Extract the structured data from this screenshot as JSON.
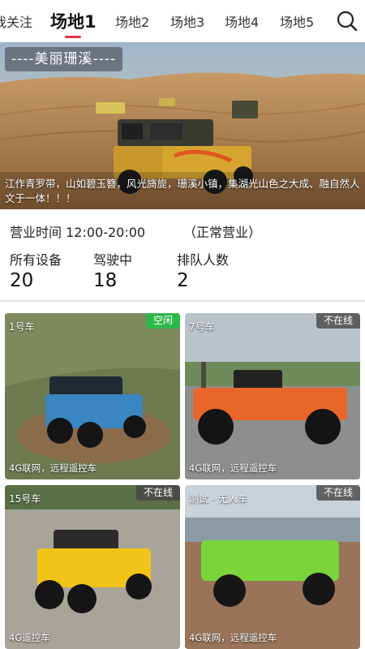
{
  "tabs": [
    {
      "label": "我关注",
      "active": false
    },
    {
      "label": "场地1",
      "active": true
    },
    {
      "label": "场地2",
      "active": false
    },
    {
      "label": "场地3",
      "active": false
    },
    {
      "label": "场地4",
      "active": false
    },
    {
      "label": "场地5",
      "active": false
    }
  ],
  "search_icon": "search-icon",
  "banner": {
    "title": "----美丽珊溪----",
    "caption": "江作青罗带，山如碧玉簪，风光旖旎，珊溪小镇，集湖光山色之大成、融自然人文于一体！！！"
  },
  "venue": {
    "hours": "营业时间 12:00-20:00",
    "status": "（正常营业）",
    "stats": [
      {
        "label": "所有设备",
        "value": "20"
      },
      {
        "label": "驾驶中",
        "value": "18"
      },
      {
        "label": "排队人数",
        "value": "2"
      }
    ]
  },
  "colors": {
    "accent": "#e2334a",
    "idle_badge": "#2eb84c",
    "offline_badge": "#464646"
  },
  "cars": [
    {
      "name": "1号车",
      "badge": "空闲",
      "badge_type": "idle",
      "desc": "4G联网，远程遥控车",
      "body_color": "#3a86c0"
    },
    {
      "name": "7号车",
      "badge": "不在线",
      "badge_type": "offline",
      "desc": "4G联网，远程遥控车",
      "body_color": "#e8662a"
    },
    {
      "name": "15号车",
      "badge": "不在线",
      "badge_type": "offline",
      "desc": "4G遥控车",
      "body_color": "#f0c419"
    },
    {
      "name": "测试 - 无人车",
      "badge": "不在线",
      "badge_type": "offline",
      "desc": "4G联网，远程遥控车",
      "body_color": "#7ad43a"
    }
  ]
}
